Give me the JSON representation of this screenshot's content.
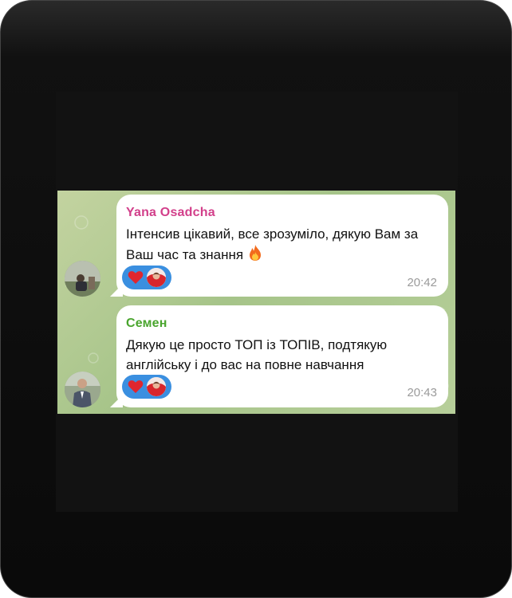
{
  "messages": [
    {
      "sender": "Yana Osadcha",
      "sender_color": "#d23f8a",
      "text": "Інтенсив цікавий, все зрозуміло, дякую Вам за Ваш час та знання",
      "emoji": "fire-icon",
      "reaction": "heart",
      "time": "20:42"
    },
    {
      "sender": "Семен",
      "sender_color": "#4aa52e",
      "text": "Дякую це просто ТОП із ТОПІВ, подтякую англійську і до вас на повне навчання",
      "reaction": "heart",
      "time": "20:43"
    }
  ],
  "colors": {
    "reaction_pill": "#3a8fe0",
    "heart": "#e0262f",
    "chat_bg": "#a6c489"
  }
}
